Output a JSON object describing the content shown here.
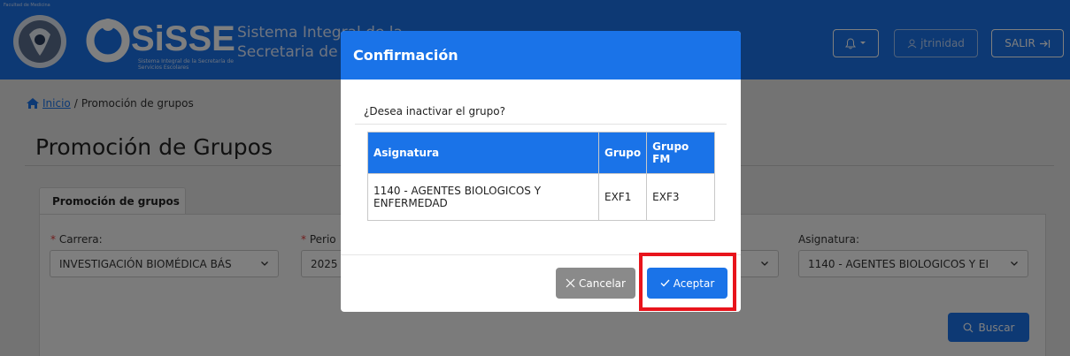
{
  "header": {
    "faculty_text": "Facultad de Medicina",
    "logo_text": "SiSSE",
    "logo_subtitle": "Sistema Integral de la Secretaría de Servicios Escolares",
    "system_title_line1": "Sistema Integral de la",
    "system_title_line2": "Secretaria de S",
    "user_name": "jtrinidad",
    "exit_label": "SALIR",
    "bell_icon": "bell-icon",
    "user_icon": "user-icon",
    "exit_icon": "exit-arrow-icon",
    "colors": {
      "primary": "#1a73e8"
    }
  },
  "breadcrumb": {
    "home_label": "Inicio",
    "separator": "/",
    "current": "Promoción de grupos"
  },
  "page": {
    "title": "Promoción de Grupos",
    "tab_label": "Promoción de grupos"
  },
  "filters": {
    "carrera_label": "Carrera:",
    "carrera_value": "INVESTIGACIÓN BIOMÉDICA BÁS",
    "periodo_label": "Perio",
    "periodo_value": "2025",
    "asignatura_label": "Asignatura:",
    "asignatura_value": "1140 - AGENTES BIOLOGICOS Y EI",
    "required_mark": "*",
    "search_label": "Buscar"
  },
  "modal": {
    "title": "Confirmación",
    "question": "¿Desea inactivar el grupo?",
    "columns": [
      "Asignatura",
      "Grupo",
      "Grupo FM"
    ],
    "rows": [
      {
        "asignatura": "1140 - AGENTES BIOLOGICOS Y ENFERMEDAD",
        "grupo": "EXF1",
        "grupo_fm": "EXF3"
      }
    ],
    "cancel_label": "Cancelar",
    "accept_label": "Aceptar"
  }
}
